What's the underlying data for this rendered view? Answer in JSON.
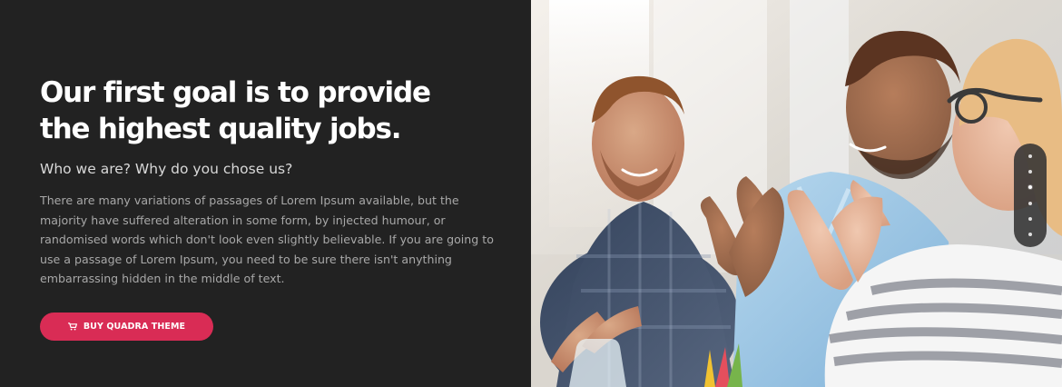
{
  "hero": {
    "headline": "Our first goal is to provide the highest quality jobs.",
    "subheading": "Who we are? Why do you chose us?",
    "body": "There are many variations of passages of Lorem Ipsum available, but the majority have suffered alteration in some form, by injected humour, or randomised words which don't look even slightly believable. If you are going to use a passage of Lorem Ipsum, you need to be sure there isn't anything embarrassing hidden in the middle of text.",
    "cta": {
      "label": "BUY QUADRA THEME",
      "icon": "cart-icon"
    }
  },
  "image": {
    "alt": "Three smiling people clapping at a meeting table"
  },
  "dots_nav": {
    "count": 6,
    "active_index": 0
  },
  "colors": {
    "background": "#222222",
    "accent": "#d92c55",
    "text_primary": "#ffffff",
    "text_secondary": "#a8a8a8"
  }
}
